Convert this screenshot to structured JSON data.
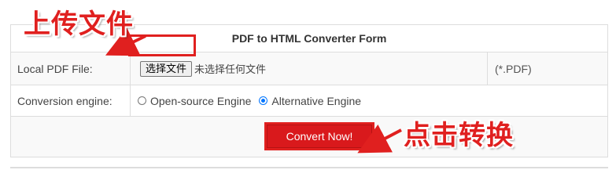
{
  "form": {
    "title": "PDF to HTML Converter Form",
    "file_row": {
      "label": "Local PDF File:",
      "choose_button": "选择文件",
      "file_status": "未选择任何文件",
      "hint": "(*.PDF)"
    },
    "engine_row": {
      "label": "Conversion engine:",
      "options": [
        {
          "label": "Open-source Engine",
          "selected": false
        },
        {
          "label": "Alternative Engine",
          "selected": true
        }
      ]
    },
    "submit": {
      "label": "Convert Now!"
    }
  },
  "annotations": {
    "upload_label": "上传文件",
    "convert_label": "点击转换",
    "color": "#e0201f"
  }
}
